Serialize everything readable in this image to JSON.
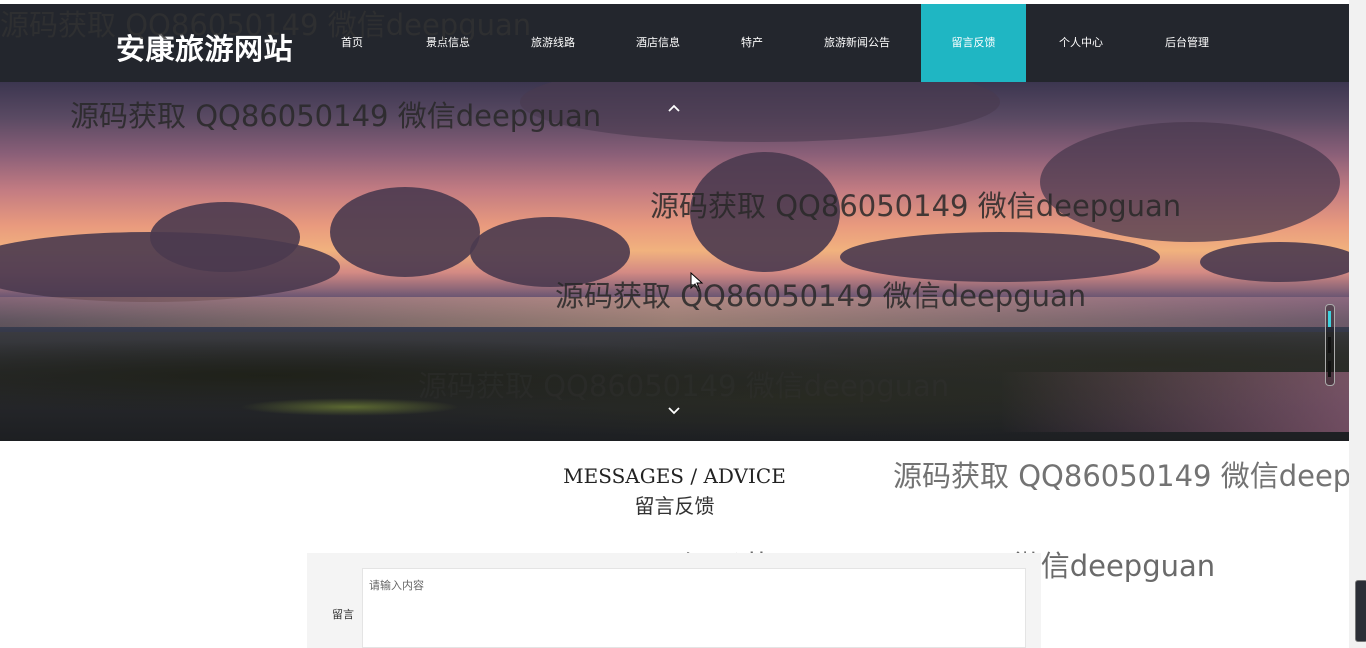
{
  "header": {
    "logo": "安康旅游网站",
    "nav": [
      {
        "label": "首页",
        "active": false
      },
      {
        "label": "景点信息",
        "active": false
      },
      {
        "label": "旅游线路",
        "active": false
      },
      {
        "label": "酒店信息",
        "active": false
      },
      {
        "label": "特产",
        "active": false
      },
      {
        "label": "旅游新闻公告",
        "active": false
      },
      {
        "label": "留言反馈",
        "active": true
      },
      {
        "label": "个人中心",
        "active": false
      },
      {
        "label": "后台管理",
        "active": false
      }
    ]
  },
  "colors": {
    "nav_bg": "#23262d",
    "accent": "#1fb6c3"
  },
  "hero": {
    "prev_icon": "chevron-up-icon",
    "next_icon": "chevron-down-icon"
  },
  "watermark": "源码获取 QQ86050149 微信deepguan",
  "section": {
    "title_en": "MESSAGES / ADVICE",
    "title_cn": "留言反馈"
  },
  "form": {
    "label": "留言",
    "placeholder": "请输入内容",
    "value": ""
  }
}
